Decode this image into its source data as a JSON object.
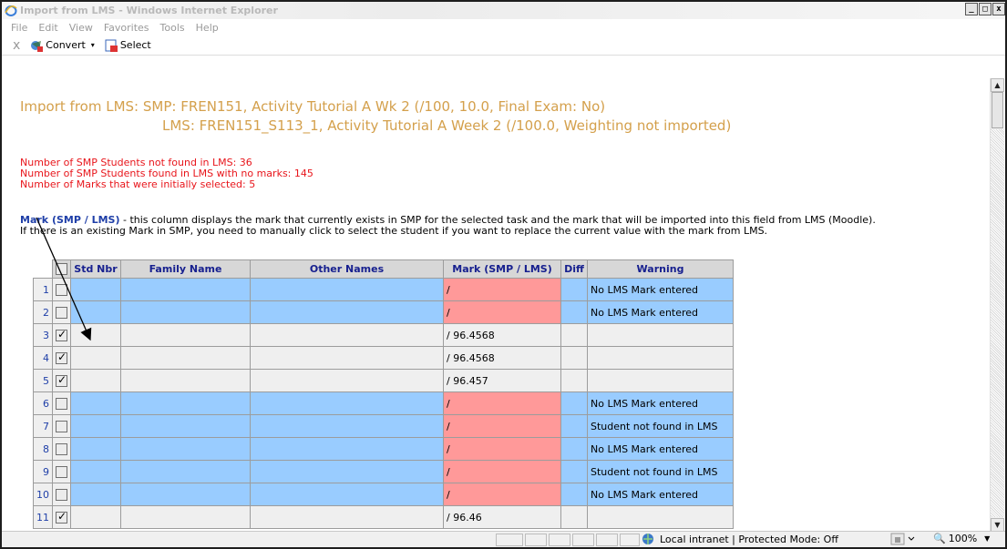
{
  "window": {
    "title": "Import from LMS - Windows Internet Explorer",
    "min_symbol": "_",
    "max_symbol": "□",
    "close_symbol": "x"
  },
  "menubar": [
    "File",
    "Edit",
    "View",
    "Favorites",
    "Tools",
    "Help"
  ],
  "commandbar": {
    "close": "x",
    "convert_label": "Convert",
    "convert_caret": "▾",
    "select_label": "Select"
  },
  "page": {
    "heading_line1": "Import from LMS: SMP: FREN151, Activity Tutorial A Wk 2 (/100, 10.0, Final Exam: No)",
    "heading_line2": "LMS: FREN151_S113_1, Activity Tutorial A Week 2 (/100.0, Weighting not imported)",
    "stats": [
      "Number of SMP Students not found in LMS: 36",
      "Number of SMP Students found in LMS with no marks: 145",
      "Number of Marks that were initially selected: 5"
    ],
    "explain_label": "Mark (SMP / LMS)",
    "explain_text": " - this column displays the mark that currently exists in SMP for the selected task and the mark that will be imported into this field from LMS (Moodle).",
    "explain_text2": "If there is an existing Mark in SMP, you need to manually click to select the student if you want to replace the current value with the mark from LMS."
  },
  "table": {
    "headers": {
      "std": "Std Nbr",
      "family": "Family Name",
      "other": "Other Names",
      "mark": "Mark (SMP / LMS)",
      "diff": "Diff",
      "warning": "Warning"
    },
    "rows": [
      {
        "num": "1",
        "checked": false,
        "mark": "/",
        "warning": "No LMS Mark entered",
        "style": "blue"
      },
      {
        "num": "2",
        "checked": false,
        "mark": "/",
        "warning": "No LMS Mark entered",
        "style": "blue"
      },
      {
        "num": "3",
        "checked": true,
        "mark": "/ 96.4568",
        "warning": "",
        "style": "grey"
      },
      {
        "num": "4",
        "checked": true,
        "mark": "/ 96.4568",
        "warning": "",
        "style": "grey"
      },
      {
        "num": "5",
        "checked": true,
        "mark": "/ 96.457",
        "warning": "",
        "style": "grey"
      },
      {
        "num": "6",
        "checked": false,
        "mark": "/",
        "warning": "No LMS Mark entered",
        "style": "blue"
      },
      {
        "num": "7",
        "checked": false,
        "mark": "/",
        "warning": "Student not found in LMS",
        "style": "blue"
      },
      {
        "num": "8",
        "checked": false,
        "mark": "/",
        "warning": "No LMS Mark entered",
        "style": "blue"
      },
      {
        "num": "9",
        "checked": false,
        "mark": "/",
        "warning": "Student not found in LMS",
        "style": "blue"
      },
      {
        "num": "10",
        "checked": false,
        "mark": "/",
        "warning": "No LMS Mark entered",
        "style": "blue"
      },
      {
        "num": "11",
        "checked": true,
        "mark": "/ 96.46",
        "warning": "",
        "style": "grey"
      }
    ]
  },
  "statusbar": {
    "zone": "Local intranet | Protected Mode: Off",
    "zoom": "100%"
  },
  "colors": {
    "heading": "#d4a04c",
    "stats": "#e8151b",
    "row_blue": "#99ccff",
    "mark_red": "#ff9999",
    "header_text": "#17208f"
  }
}
